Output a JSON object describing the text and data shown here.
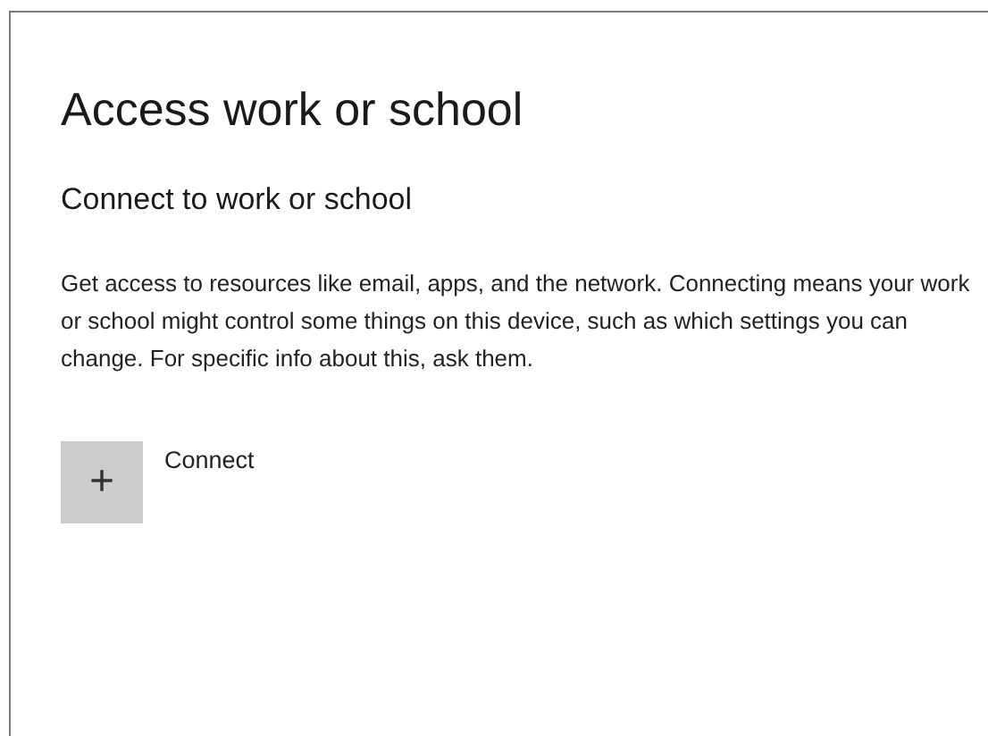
{
  "page": {
    "title": "Access work or school"
  },
  "section": {
    "heading": "Connect to work or school",
    "description": "Get access to resources like email, apps, and the network. Connecting means your work or school might control some things on this device, such as which settings you can change. For specific info about this, ask them."
  },
  "connect_button": {
    "icon": "+",
    "label": "Connect"
  }
}
